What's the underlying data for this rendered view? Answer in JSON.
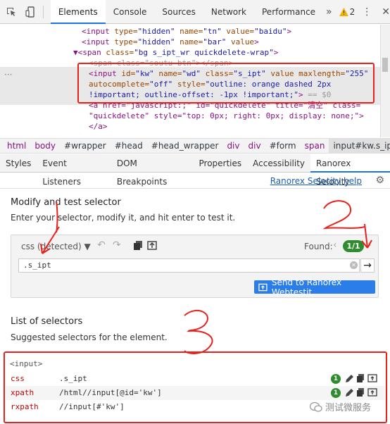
{
  "toolbar": {
    "tabs": [
      "Elements",
      "Console",
      "Sources",
      "Network",
      "Performance"
    ],
    "more": "»",
    "warning_count": "2"
  },
  "tree": {
    "lines": [
      {
        "pre": "<",
        "tag": "input",
        "parts": [
          [
            " type=",
            "\"hidden\""
          ],
          [
            " name=",
            "\"tn\""
          ],
          [
            " value=",
            "\"baidu\""
          ]
        ],
        "post": ">"
      },
      {
        "pre": "<",
        "tag": "input",
        "parts": [
          [
            " type=",
            "\"hidden\""
          ],
          [
            " name=",
            "\"bar\""
          ],
          [
            " value",
            ""
          ]
        ],
        "post": ">"
      },
      {
        "pre": "▼<",
        "tag": "span",
        "parts": [
          [
            " class=",
            "\"bg s_ipt_wr quickdelete-wrap\""
          ]
        ],
        "post": ">"
      },
      {
        "text": "<span class=\"soutu-btn\"></span>"
      },
      {
        "pre": "<",
        "tag": "input",
        "parts": [
          [
            " id=",
            "\"kw\""
          ],
          [
            " name=",
            "\"wd\""
          ],
          [
            " class=",
            "\"s_ipt\""
          ],
          [
            " value maxlength=",
            "\"255\""
          ]
        ],
        "post": ""
      },
      {
        "parts": [
          [
            "autocomplete=",
            "\"off\""
          ],
          [
            " style=",
            "\"outline: orange dashed 2px"
          ]
        ],
        "post": ""
      },
      {
        "parts": [
          [
            "",
            "!important; outline-offset: -1px !important;\""
          ]
        ],
        "post": ">",
        "after": " == $0"
      },
      {
        "text": "<a href=\"javascript:;\" id=\"quickdelete\" title=\"清空\" class="
      },
      {
        "text": "\"quickdelete\" style=\"top: 0px; right: 0px; display: none;\">"
      },
      {
        "text": "</a>"
      }
    ]
  },
  "breadcrumbs": [
    "html",
    "body",
    "#wrapper",
    "#head",
    "#head_wrapper",
    "div",
    "div",
    "#form",
    "span",
    "input#kw.s_ipt"
  ],
  "subtabs": [
    "Styles",
    "Event Listeners",
    "DOM Breakpoints",
    "Properties",
    "Accessibility",
    "Ranorex Selocity"
  ],
  "help_link": "Ranorex Selocity help",
  "modify": {
    "title": "Modify and test selector",
    "subtitle": "Enter your selector, modify it, and hit enter to test it.",
    "selector_type": "css (detected) ▼",
    "found_label": "Found:",
    "found_badge": "1/1",
    "input_value": ".s_ipt",
    "send_button": "Send to Ranorex Webtestit"
  },
  "list": {
    "title": "List of selectors",
    "subtitle": "Suggested selectors for the element.",
    "element": "<input>",
    "rows": [
      {
        "type": "css",
        "value": ".s_ipt",
        "count": "1"
      },
      {
        "type": "xpath",
        "value": "/html//input[@id='kw']",
        "count": "1"
      },
      {
        "type": "rxpath",
        "value": "//input[#'kw']",
        "count": ""
      }
    ]
  },
  "annotations": [
    "1",
    "2",
    "3"
  ],
  "watermark": "测试微服务",
  "colors": {
    "accent": "#1a73e8",
    "annotation": "#e8211d",
    "badge": "#2f8d2f",
    "button": "#2b7de9"
  }
}
